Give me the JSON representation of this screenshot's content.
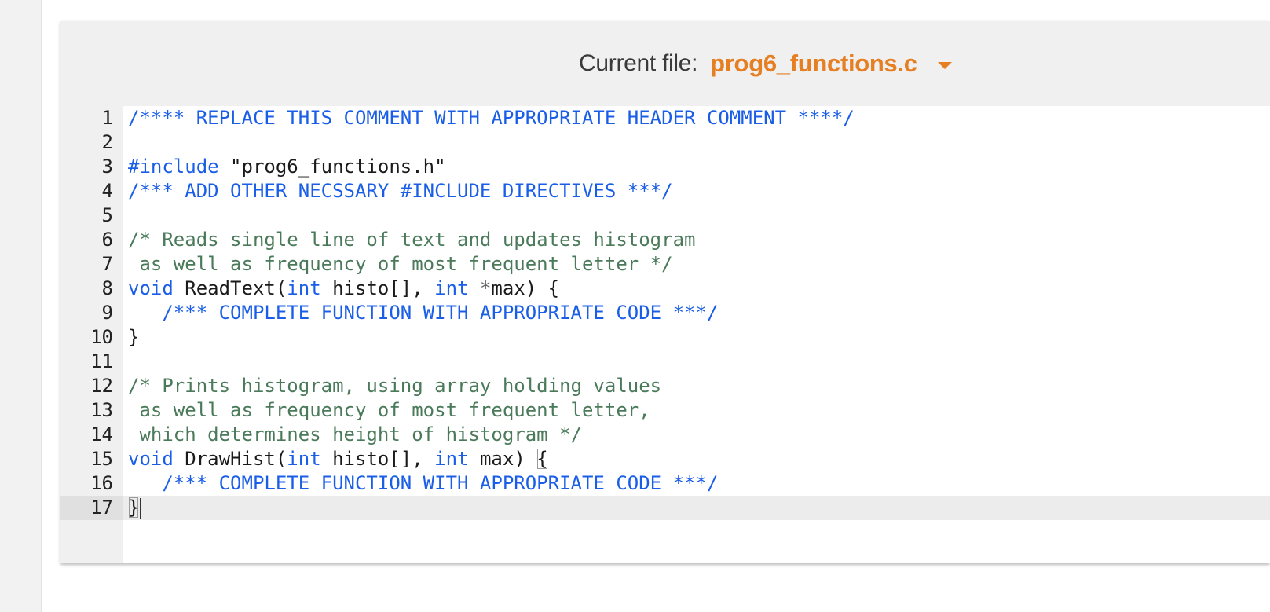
{
  "header": {
    "current_file_label": "Current file:",
    "current_file_name": "prog6_functions.c",
    "caret_icon": "chevron-down-icon",
    "accent_color": "#e67e22"
  },
  "editor": {
    "lines": [
      {
        "num": "1",
        "text": "/**** REPLACE THIS COMMENT WITH APPROPRIATE HEADER COMMENT ****/"
      },
      {
        "num": "2",
        "text": ""
      },
      {
        "num": "3",
        "text": "#include \"prog6_functions.h\""
      },
      {
        "num": "4",
        "text": "/*** ADD OTHER NECSSARY #INCLUDE DIRECTIVES ***/"
      },
      {
        "num": "5",
        "text": ""
      },
      {
        "num": "6",
        "text": "/* Reads single line of text and updates histogram"
      },
      {
        "num": "7",
        "text": " as well as frequency of most frequent letter */"
      },
      {
        "num": "8",
        "text": "void ReadText(int histo[], int *max) {"
      },
      {
        "num": "9",
        "text": "   /*** COMPLETE FUNCTION WITH APPROPRIATE CODE ***/"
      },
      {
        "num": "10",
        "text": "}"
      },
      {
        "num": "11",
        "text": ""
      },
      {
        "num": "12",
        "text": "/* Prints histogram, using array holding values"
      },
      {
        "num": "13",
        "text": " as well as frequency of most frequent letter,"
      },
      {
        "num": "14",
        "text": " which determines height of histogram */"
      },
      {
        "num": "15",
        "text": "void DrawHist(int histo[], int max) {"
      },
      {
        "num": "16",
        "text": "   /*** COMPLETE FUNCTION WITH APPROPRIATE CODE ***/"
      },
      {
        "num": "17",
        "text": "}"
      }
    ],
    "active_line": "17",
    "colors": {
      "keyword": "#1a5ee8",
      "comment": "#4a7a5a",
      "text": "#1a1a1a"
    }
  }
}
